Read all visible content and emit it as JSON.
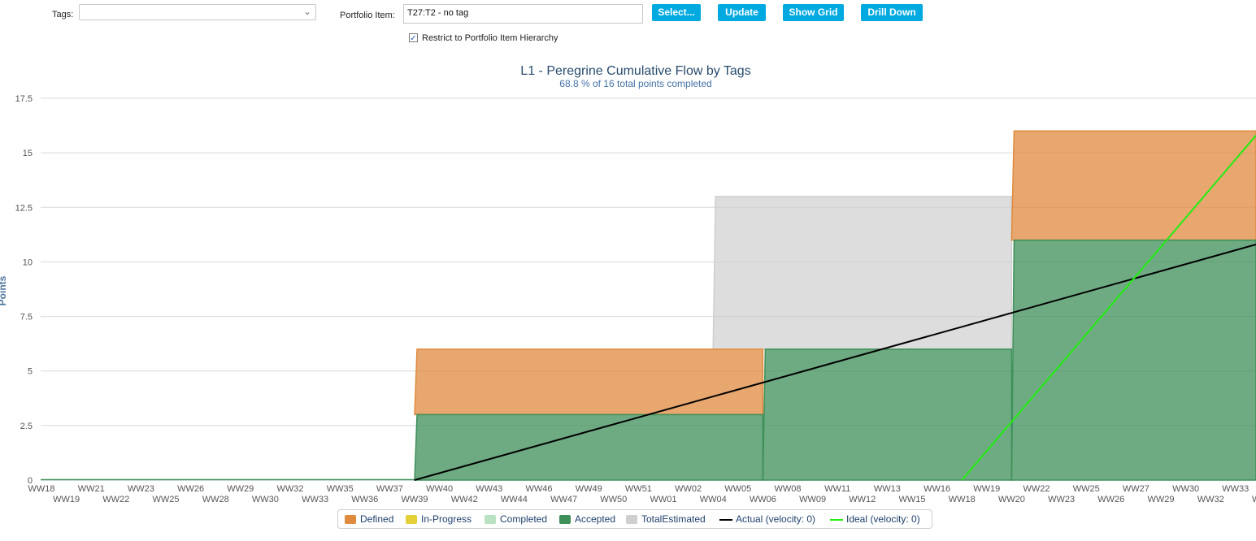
{
  "toolbar": {
    "tags_label": "Tags:",
    "tags_value": "",
    "portfolio_label": "Portfolio Item:",
    "portfolio_value": "T27:T2 - no tag",
    "select_label": "Select...",
    "update_label": "Update",
    "show_grid_label": "Show Grid",
    "drill_down_label": "Drill Down",
    "restrict_label": "Restrict to Portfolio Item Hierarchy",
    "restrict_checked": true,
    "button_color": "#00a9e0"
  },
  "chart_data": {
    "type": "area",
    "title": "L1 - Peregrine Cumulative Flow by Tags",
    "subtitle": "68.8 % of 16 total points completed",
    "ylabel": "Points",
    "xlabel": "",
    "ylim": [
      0,
      17.5
    ],
    "yticks": [
      "0",
      "2.5",
      "5",
      "7.5",
      "10",
      "12.5",
      "15",
      "17.5"
    ],
    "grid": true,
    "legend_position": "bottom-center",
    "x_ticks_row1": [
      "WW18",
      "WW21",
      "WW23",
      "WW26",
      "WW29",
      "WW32",
      "WW35",
      "WW37",
      "WW40",
      "WW43",
      "WW46",
      "WW49",
      "WW51",
      "WW02",
      "WW05",
      "WW08",
      "WW11",
      "WW13",
      "WW16",
      "WW19",
      "WW22",
      "WW25",
      "WW27",
      "WW30",
      "WW33"
    ],
    "x_ticks_row2": [
      "WW19",
      "WW22",
      "WW25",
      "WW28",
      "WW30",
      "WW33",
      "WW36",
      "WW39",
      "WW42",
      "WW44",
      "WW47",
      "WW50",
      "WW01",
      "WW04",
      "WW06",
      "WW09",
      "WW12",
      "WW15",
      "WW18",
      "WW20",
      "WW23",
      "WW26",
      "WW29",
      "WW32",
      "WW"
    ],
    "series": [
      {
        "name": "Defined",
        "color": "#e08a3e",
        "kind": "area",
        "steps": [
          {
            "from": "WW39",
            "to": "WW06",
            "y0": 3,
            "y1": 6
          },
          {
            "from": "WW20",
            "to": "WW",
            "y0": 11,
            "y1": 16
          }
        ]
      },
      {
        "name": "In-Progress",
        "color": "#e5d038",
        "kind": "area",
        "steps": []
      },
      {
        "name": "Completed",
        "color": "#b9e2c2",
        "kind": "area",
        "steps": []
      },
      {
        "name": "Accepted",
        "color": "#3e8f58",
        "kind": "area",
        "steps": [
          {
            "from": "WW39",
            "to": "WW06",
            "y0": 0,
            "y1": 3
          },
          {
            "from": "WW06",
            "to": "WW20",
            "y0": 0,
            "y1": 6
          },
          {
            "from": "WW20",
            "to": "WW",
            "y0": 0,
            "y1": 11
          }
        ]
      },
      {
        "name": "TotalEstimated",
        "color": "#cfcfcf",
        "kind": "area",
        "steps": [
          {
            "from": "WW04",
            "to": "WW20",
            "y0": 6,
            "y1": 13
          }
        ]
      },
      {
        "name": "Actual (velocity: 0)",
        "color": "#000000",
        "kind": "line",
        "points": [
          {
            "x": "WW39",
            "y": 0
          },
          {
            "x": "WW",
            "y": 10.8
          }
        ]
      },
      {
        "name": "Ideal (velocity: 0)",
        "color": "#22ee11",
        "kind": "line",
        "points": [
          {
            "x": "WW18",
            "y": 0
          },
          {
            "x": "WW",
            "y": 15.8
          }
        ]
      }
    ]
  }
}
